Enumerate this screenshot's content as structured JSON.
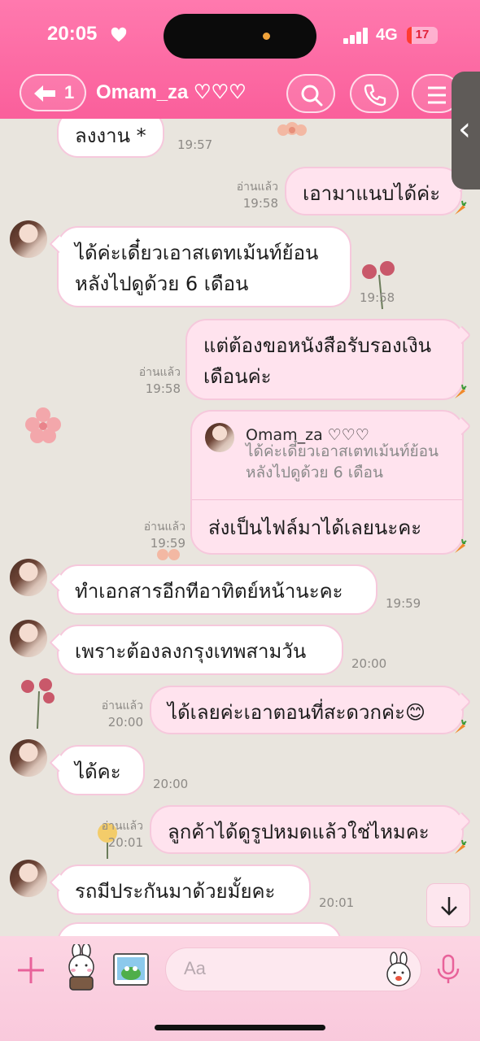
{
  "status_bar": {
    "time": "20:05",
    "network": "4G",
    "battery": "17"
  },
  "header": {
    "back_count": "1",
    "title": "Omam_za ♡♡♡"
  },
  "messages": [
    {
      "side": "in",
      "text": "ลงงาน *",
      "time": "19:57"
    },
    {
      "side": "out",
      "text": "เอามาแนบได้ค่ะ",
      "read": "อ่านแล้ว",
      "time": "19:58"
    },
    {
      "side": "in",
      "lines": [
        "ได้ค่ะเดี๋ยวเอาสเตทเม้นท์ย้อน",
        "หลังไปดูด้วย 6 เดือน"
      ],
      "time": "19:58"
    },
    {
      "side": "out",
      "lines": [
        "แต่ต้องขอหนังสือรับรองเงิน",
        "เดือนค่ะ"
      ],
      "read": "อ่านแล้ว",
      "time": "19:58"
    },
    {
      "side": "out",
      "reply": {
        "name": "Omam_za ♡♡♡",
        "lines": [
          "ได้ค่ะเดี๋ยวเอาสเตทเม้นท์ย้อน",
          "หลังไปดูด้วย 6 เดือน"
        ]
      },
      "text": "ส่งเป็นไฟล์มาได้เลยนะคะ",
      "read": "อ่านแล้ว",
      "time": "19:59"
    },
    {
      "side": "in",
      "text": "ทำเอกสารอีกทีอาทิตย์หน้านะคะ",
      "time": "19:59"
    },
    {
      "side": "in",
      "text": "เพราะต้องลงกรุงเทพสามวัน",
      "time": "20:00"
    },
    {
      "side": "out",
      "text": "ได้เลยค่ะเอาตอนที่สะดวกค่ะ😊",
      "read": "อ่านแล้ว",
      "time": "20:00"
    },
    {
      "side": "in",
      "text": "ได้คะ",
      "time": "20:00"
    },
    {
      "side": "out",
      "text": "ลูกค้าได้ดูรูปหมดแล้วใช่ไหมคะ",
      "read": "อ่านแล้ว",
      "time": "20:01"
    },
    {
      "side": "in",
      "text": "รถมีประกันมาด้วยมั้ยคะ",
      "time": "20:01"
    }
  ],
  "input": {
    "placeholder": "Aa"
  },
  "colors": {
    "header_pink": "#fa5f9b",
    "bubble_out": "#ffe3ee",
    "bubble_border": "#f6c8dc"
  },
  "icons": [
    "heart-icon",
    "back-arrow-icon",
    "search-icon",
    "phone-icon",
    "menu-icon",
    "chevron-left-icon",
    "plus-icon",
    "sticker-icon",
    "photo-icon",
    "emoji-icon",
    "mic-icon",
    "arrow-down-icon"
  ]
}
